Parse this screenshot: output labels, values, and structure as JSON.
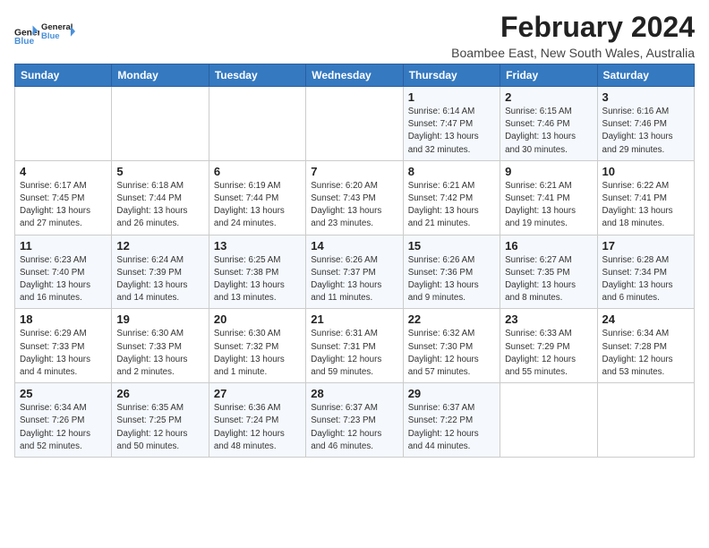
{
  "header": {
    "logo_line1": "General",
    "logo_line2": "Blue",
    "title": "February 2024",
    "subtitle": "Boambee East, New South Wales, Australia"
  },
  "columns": [
    "Sunday",
    "Monday",
    "Tuesday",
    "Wednesday",
    "Thursday",
    "Friday",
    "Saturday"
  ],
  "weeks": [
    [
      {
        "day": "",
        "info": ""
      },
      {
        "day": "",
        "info": ""
      },
      {
        "day": "",
        "info": ""
      },
      {
        "day": "",
        "info": ""
      },
      {
        "day": "1",
        "info": "Sunrise: 6:14 AM\nSunset: 7:47 PM\nDaylight: 13 hours\nand 32 minutes."
      },
      {
        "day": "2",
        "info": "Sunrise: 6:15 AM\nSunset: 7:46 PM\nDaylight: 13 hours\nand 30 minutes."
      },
      {
        "day": "3",
        "info": "Sunrise: 6:16 AM\nSunset: 7:46 PM\nDaylight: 13 hours\nand 29 minutes."
      }
    ],
    [
      {
        "day": "4",
        "info": "Sunrise: 6:17 AM\nSunset: 7:45 PM\nDaylight: 13 hours\nand 27 minutes."
      },
      {
        "day": "5",
        "info": "Sunrise: 6:18 AM\nSunset: 7:44 PM\nDaylight: 13 hours\nand 26 minutes."
      },
      {
        "day": "6",
        "info": "Sunrise: 6:19 AM\nSunset: 7:44 PM\nDaylight: 13 hours\nand 24 minutes."
      },
      {
        "day": "7",
        "info": "Sunrise: 6:20 AM\nSunset: 7:43 PM\nDaylight: 13 hours\nand 23 minutes."
      },
      {
        "day": "8",
        "info": "Sunrise: 6:21 AM\nSunset: 7:42 PM\nDaylight: 13 hours\nand 21 minutes."
      },
      {
        "day": "9",
        "info": "Sunrise: 6:21 AM\nSunset: 7:41 PM\nDaylight: 13 hours\nand 19 minutes."
      },
      {
        "day": "10",
        "info": "Sunrise: 6:22 AM\nSunset: 7:41 PM\nDaylight: 13 hours\nand 18 minutes."
      }
    ],
    [
      {
        "day": "11",
        "info": "Sunrise: 6:23 AM\nSunset: 7:40 PM\nDaylight: 13 hours\nand 16 minutes."
      },
      {
        "day": "12",
        "info": "Sunrise: 6:24 AM\nSunset: 7:39 PM\nDaylight: 13 hours\nand 14 minutes."
      },
      {
        "day": "13",
        "info": "Sunrise: 6:25 AM\nSunset: 7:38 PM\nDaylight: 13 hours\nand 13 minutes."
      },
      {
        "day": "14",
        "info": "Sunrise: 6:26 AM\nSunset: 7:37 PM\nDaylight: 13 hours\nand 11 minutes."
      },
      {
        "day": "15",
        "info": "Sunrise: 6:26 AM\nSunset: 7:36 PM\nDaylight: 13 hours\nand 9 minutes."
      },
      {
        "day": "16",
        "info": "Sunrise: 6:27 AM\nSunset: 7:35 PM\nDaylight: 13 hours\nand 8 minutes."
      },
      {
        "day": "17",
        "info": "Sunrise: 6:28 AM\nSunset: 7:34 PM\nDaylight: 13 hours\nand 6 minutes."
      }
    ],
    [
      {
        "day": "18",
        "info": "Sunrise: 6:29 AM\nSunset: 7:33 PM\nDaylight: 13 hours\nand 4 minutes."
      },
      {
        "day": "19",
        "info": "Sunrise: 6:30 AM\nSunset: 7:33 PM\nDaylight: 13 hours\nand 2 minutes."
      },
      {
        "day": "20",
        "info": "Sunrise: 6:30 AM\nSunset: 7:32 PM\nDaylight: 13 hours\nand 1 minute."
      },
      {
        "day": "21",
        "info": "Sunrise: 6:31 AM\nSunset: 7:31 PM\nDaylight: 12 hours\nand 59 minutes."
      },
      {
        "day": "22",
        "info": "Sunrise: 6:32 AM\nSunset: 7:30 PM\nDaylight: 12 hours\nand 57 minutes."
      },
      {
        "day": "23",
        "info": "Sunrise: 6:33 AM\nSunset: 7:29 PM\nDaylight: 12 hours\nand 55 minutes."
      },
      {
        "day": "24",
        "info": "Sunrise: 6:34 AM\nSunset: 7:28 PM\nDaylight: 12 hours\nand 53 minutes."
      }
    ],
    [
      {
        "day": "25",
        "info": "Sunrise: 6:34 AM\nSunset: 7:26 PM\nDaylight: 12 hours\nand 52 minutes."
      },
      {
        "day": "26",
        "info": "Sunrise: 6:35 AM\nSunset: 7:25 PM\nDaylight: 12 hours\nand 50 minutes."
      },
      {
        "day": "27",
        "info": "Sunrise: 6:36 AM\nSunset: 7:24 PM\nDaylight: 12 hours\nand 48 minutes."
      },
      {
        "day": "28",
        "info": "Sunrise: 6:37 AM\nSunset: 7:23 PM\nDaylight: 12 hours\nand 46 minutes."
      },
      {
        "day": "29",
        "info": "Sunrise: 6:37 AM\nSunset: 7:22 PM\nDaylight: 12 hours\nand 44 minutes."
      },
      {
        "day": "",
        "info": ""
      },
      {
        "day": "",
        "info": ""
      }
    ]
  ]
}
